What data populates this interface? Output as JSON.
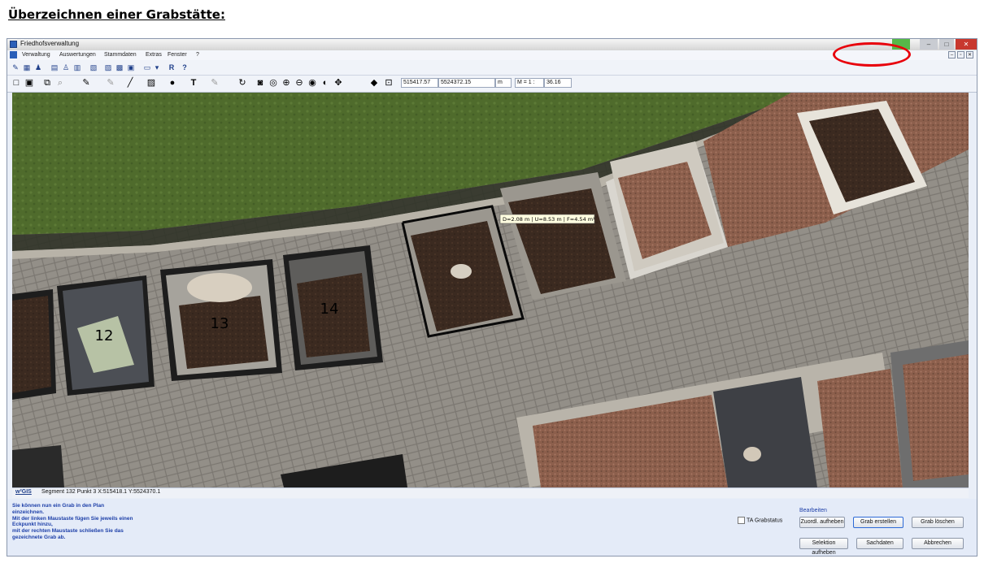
{
  "document": {
    "heading": "Überzeichnen einer Grabstätte:"
  },
  "window": {
    "title": "Friedhofsverwaltung",
    "controls": {
      "minimize": "–",
      "maximize": "□",
      "close": "✕"
    },
    "mdi_controls": [
      "–",
      "▫",
      "✕"
    ]
  },
  "menu": {
    "items": [
      "Verwaltung",
      "Auswertungen",
      "Stammdaten",
      "Extras",
      "Fenster",
      "?"
    ]
  },
  "toolbar": {
    "coord_x": "515417.57",
    "coord_y": "5524372.15",
    "unit": "m",
    "scale_label": "M = 1 :",
    "scale_value": "36.16"
  },
  "map": {
    "grave_labels": [
      "12",
      "13",
      "14"
    ],
    "measure_text": "D=2.08 m | U=8.53 m | F=4.54 m²"
  },
  "status": {
    "logo": "w²GIS",
    "text": "Segment 132  Punkt 3  X:515418.1  Y:5524370.1"
  },
  "instructions": [
    "Sie können nun ein Grab in den Plan",
    "einzeichnen.",
    "Mit der linken Maustaste fügen Sie jeweils einen",
    "Eckpunkt hinzu,",
    "mit der rechten Maustaste schließen Sie das",
    "gezeichnete Grab ab."
  ],
  "panel": {
    "checkbox_label": "TA Grabstatus",
    "group_label": "Bearbeiten",
    "buttons": {
      "zuordnung": "Zuordl. aufheben",
      "grab_erstellen": "Grab erstellen",
      "grab_loeschen": "Grab löschen",
      "selektion": "Selektion aufheben",
      "sachdaten": "Sachdaten",
      "abbrechen": "Abbrechen"
    }
  },
  "colors": {
    "highlight": "#e8000b",
    "instruction_text": "#1d3fa8"
  }
}
